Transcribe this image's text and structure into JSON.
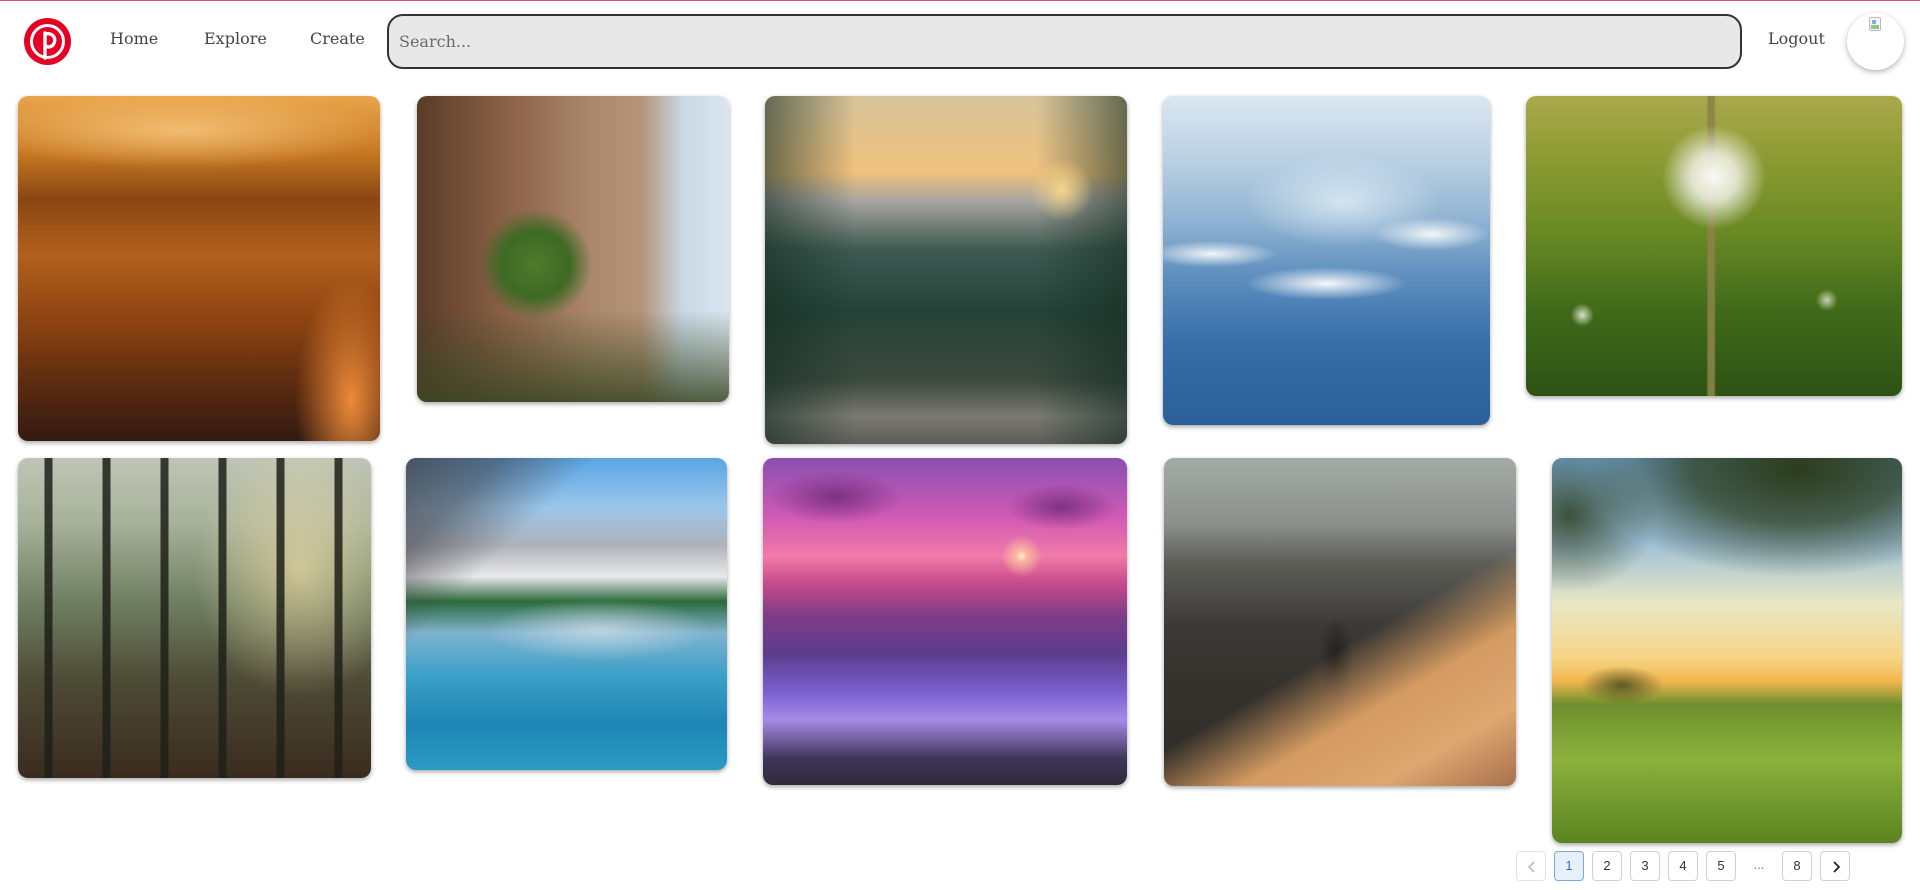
{
  "header": {
    "logo_icon": "pinterest-logo",
    "brand_color": "#e60023",
    "nav": [
      {
        "label": "Home"
      },
      {
        "label": "Explore"
      },
      {
        "label": "Create"
      }
    ],
    "search": {
      "placeholder": "Search...",
      "value": ""
    },
    "logout_label": "Logout",
    "avatar_icon": "broken-image-icon"
  },
  "pins": [
    {
      "id": "pin-1",
      "subject": "golden-grass-sunset"
    },
    {
      "id": "pin-2",
      "subject": "rock-cliff-with-moss"
    },
    {
      "id": "pin-3",
      "subject": "mountain-forest-sunset"
    },
    {
      "id": "pin-4",
      "subject": "blue-mountains-clouds"
    },
    {
      "id": "pin-5",
      "subject": "dandelion-field"
    },
    {
      "id": "pin-6",
      "subject": "misty-pine-forest"
    },
    {
      "id": "pin-7",
      "subject": "mountain-lake-reflection"
    },
    {
      "id": "pin-8",
      "subject": "purple-ocean-sunset"
    },
    {
      "id": "pin-9",
      "subject": "hiker-on-dunes"
    },
    {
      "id": "pin-10",
      "subject": "green-field-tree-branches"
    }
  ],
  "pagination": {
    "prev_icon": "chevron-left-icon",
    "next_icon": "chevron-right-icon",
    "pages": [
      "1",
      "2",
      "3",
      "4",
      "5"
    ],
    "ellipsis": "...",
    "last_page": "8",
    "current": "1",
    "active_color": "#2d6bc4"
  }
}
